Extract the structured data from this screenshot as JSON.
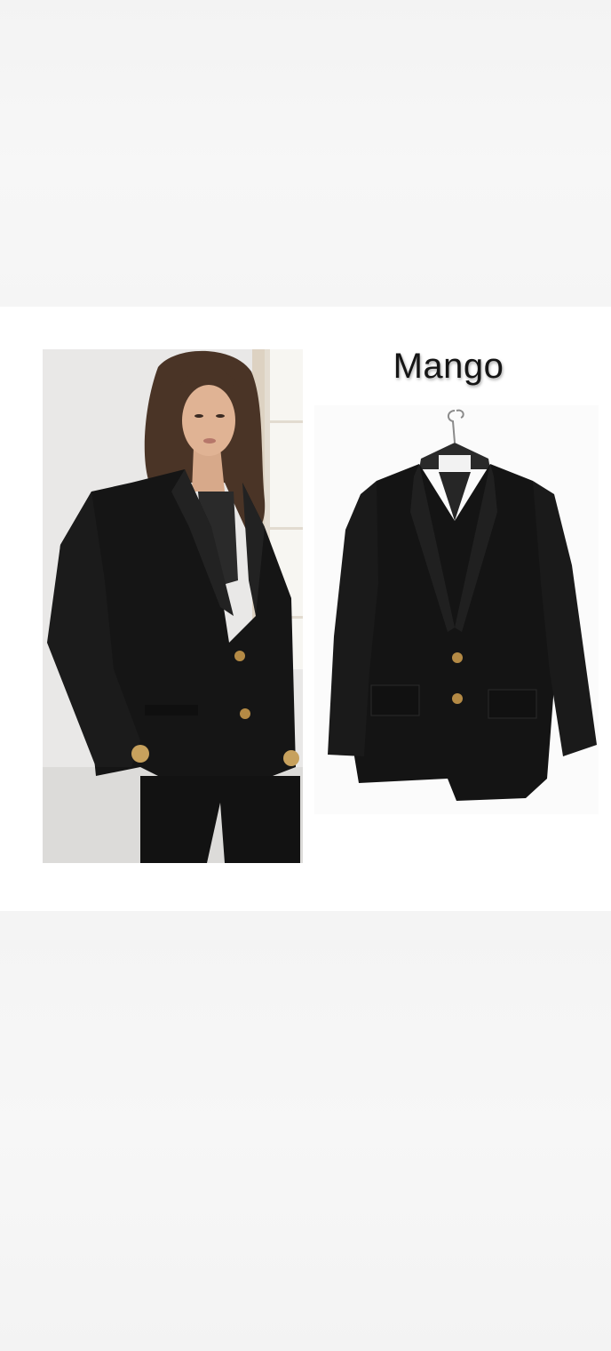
{
  "brand": {
    "title": "Mango"
  },
  "images": {
    "model_photo": {
      "alt": "woman-wearing-black-blazer"
    },
    "product_photo": {
      "alt": "black-blazer-on-hanger"
    }
  },
  "colors": {
    "background": "#f6f6f6",
    "card": "#ffffff",
    "blazer": "#141414",
    "button_gold": "#b48a45"
  }
}
